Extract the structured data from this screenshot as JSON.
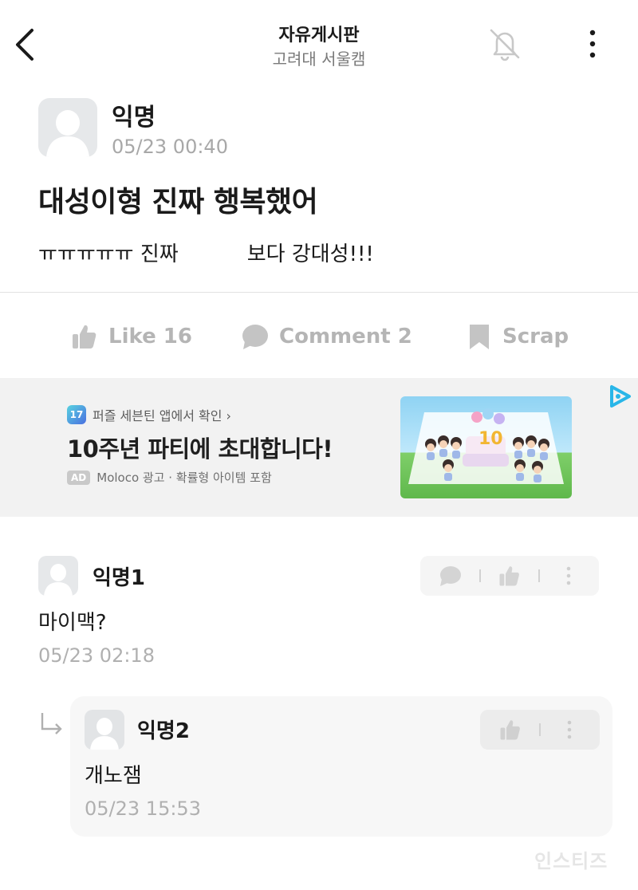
{
  "header": {
    "title": "자유게시판",
    "subtitle": "고려대 서울캠",
    "icons": {
      "back": "chevron-left-icon",
      "bell": "bell-off-icon",
      "more": "more-vertical-icon"
    }
  },
  "post": {
    "author": "익명",
    "time": "05/23 00:40",
    "title": "대성이형 진짜 행복했어",
    "body_before": "ㅠㅠㅠㅠㅠ 진짜",
    "body_after": "보다 강대성!!!",
    "actions": {
      "like_label": "Like 16",
      "comment_label": "Comment 2",
      "scrap_label": "Scrap"
    }
  },
  "ad": {
    "source": "퍼즐 세븐틴 앱에서 확인 ›",
    "headline": "10주년 파티에 초대합니다!",
    "badge": "AD",
    "meta": "Moloco 광고 · 확률형 아이템 포함",
    "image_label": "10"
  },
  "comments": [
    {
      "author": "익명1",
      "text": "마이맥?",
      "time": "05/23 02:18",
      "replies": [
        {
          "author": "익명2",
          "text": "개노잼",
          "time": "05/23 15:53"
        }
      ]
    }
  ],
  "watermark": "인스티즈",
  "colors": {
    "muted": "#b5b5b5",
    "divider": "#e2e2e2",
    "ad_bg": "#f2f2f2",
    "adchoices": "#29b6e8"
  }
}
